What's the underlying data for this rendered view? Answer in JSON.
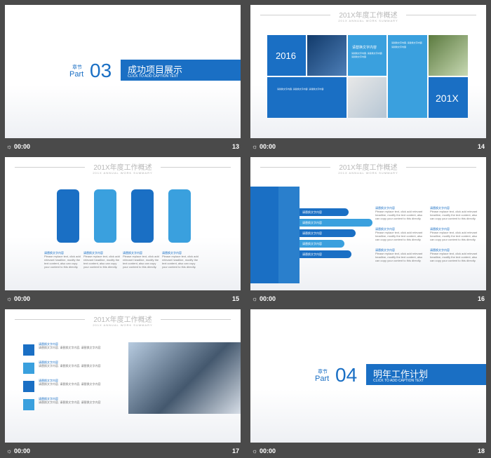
{
  "slides": [
    {
      "num": "13",
      "time": "00:00",
      "chapter": "章节",
      "part": "Part",
      "part_no": "03",
      "title": "成功项目展示",
      "caption": "CLICK TO ADD CAPTION TEXT"
    },
    {
      "num": "14",
      "time": "00:00",
      "heading": "201X年度工作概述",
      "sub": "201X ANNUAL WORK SUMMARY",
      "year1": "2016",
      "year2": "201X",
      "box_title": "请替换文字内容",
      "text": "请替换文字内容, 请替换文字内容, 请替换文字内容"
    },
    {
      "num": "15",
      "time": "00:00",
      "heading": "201X年度工作概述",
      "sub": "201X ANNUAL WORK SUMMARY",
      "item_title": "请替换文字内容",
      "item_text": "Please replace text, click add relevant headline, modify the text content, also can copy your content to this directly."
    },
    {
      "num": "16",
      "time": "00:00",
      "heading": "201X年度工作概述",
      "sub": "201X ANNUAL WORK SUMMARY",
      "arrow_label": "请替换文字内容",
      "item_title": "请替换文字内容",
      "item_text": "Please replace text, click add relevant headline, modify the text content, also can copy your content to this directly."
    },
    {
      "num": "17",
      "time": "00:00",
      "heading": "201X年度工作概述",
      "sub": "201X ANNUAL WORK SUMMARY",
      "item_title": "请替换文字内容",
      "item_text": "请替换文字内容, 请替换文字内容, 请替换文字内容"
    },
    {
      "num": "18",
      "time": "00:00",
      "chapter": "章节",
      "part": "Part",
      "part_no": "04",
      "title": "明年工作计划",
      "caption": "CLICK TO ADD CAPTION TEXT"
    }
  ],
  "colors": {
    "blue": "#1a6fc4",
    "light_blue": "#3aa0de",
    "bg": "#4a4a4a"
  },
  "icons": {
    "clock": "clock-icon"
  }
}
